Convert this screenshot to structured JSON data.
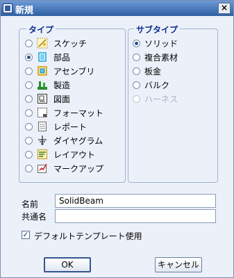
{
  "window": {
    "title": "新規",
    "close_glyph": "×"
  },
  "type_group": {
    "legend": "タイプ",
    "items": [
      {
        "label": "スケッチ",
        "icon": "sketch-icon",
        "selected": false
      },
      {
        "label": "部品",
        "icon": "part-icon",
        "selected": true
      },
      {
        "label": "アセンブリ",
        "icon": "assembly-icon",
        "selected": false
      },
      {
        "label": "製造",
        "icon": "manufacturing-icon",
        "selected": false
      },
      {
        "label": "図面",
        "icon": "drawing-icon",
        "selected": false
      },
      {
        "label": "フォーマット",
        "icon": "format-icon",
        "selected": false
      },
      {
        "label": "レポート",
        "icon": "report-icon",
        "selected": false
      },
      {
        "label": "ダイヤグラム",
        "icon": "diagram-icon",
        "selected": false
      },
      {
        "label": "レイアウト",
        "icon": "layout-icon",
        "selected": false
      },
      {
        "label": "マークアップ",
        "icon": "markup-icon",
        "selected": false
      }
    ]
  },
  "subtype_group": {
    "legend": "サブタイプ",
    "items": [
      {
        "label": "ソリッド",
        "selected": true,
        "enabled": true
      },
      {
        "label": "複合素材",
        "selected": false,
        "enabled": true
      },
      {
        "label": "板金",
        "selected": false,
        "enabled": true
      },
      {
        "label": "バルク",
        "selected": false,
        "enabled": true
      },
      {
        "label": "ハーネス",
        "selected": false,
        "enabled": false
      }
    ]
  },
  "name": {
    "label": "名前",
    "value": "SolidBeam"
  },
  "common_name": {
    "label": "共通名",
    "value": ""
  },
  "default_template": {
    "label": "デフォルトテンプレート使用",
    "checked": true,
    "check_glyph": "✓"
  },
  "buttons": {
    "ok": "OK",
    "cancel": "キャンセル"
  }
}
